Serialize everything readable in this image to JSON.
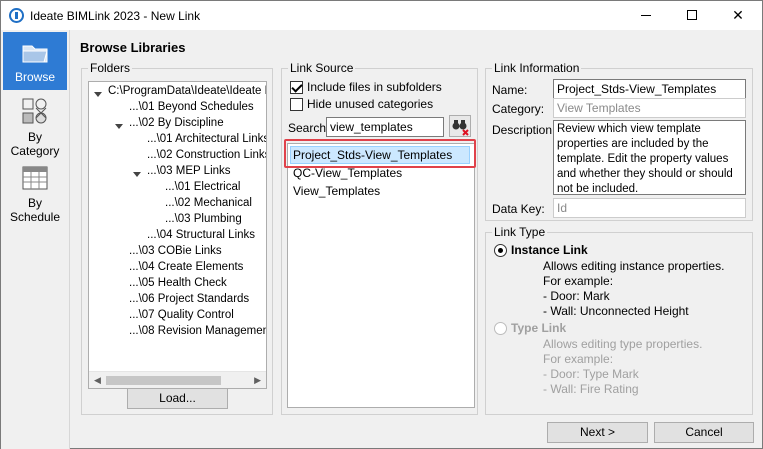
{
  "window": {
    "title": "Ideate BIMLink 2023 - New Link",
    "minimize": "—",
    "maximize": "□",
    "close": "✕"
  },
  "sidebar": {
    "items": [
      {
        "label": "Browse",
        "icon": "folder-icon"
      },
      {
        "label": "By Category",
        "icon": "category-icon"
      },
      {
        "label": "By Schedule",
        "icon": "schedule-icon"
      }
    ]
  },
  "header": "Browse Libraries",
  "folders": {
    "legend": "Folders",
    "tree": [
      "C:\\ProgramData\\Ideate\\Ideate BI",
      "...\\01 Beyond Schedules",
      "...\\02 By Discipline",
      "...\\01 Architectural Links",
      "...\\02 Construction Links",
      "...\\03 MEP Links",
      "...\\01 Electrical",
      "...\\02 Mechanical",
      "...\\03 Plumbing",
      "...\\04 Structural Links",
      "...\\03 COBie Links",
      "...\\04 Create Elements",
      "...\\05 Health Check",
      "...\\06 Project Standards",
      "...\\07 Quality Control",
      "...\\08 Revision Management"
    ],
    "load_label": "Load..."
  },
  "link_source": {
    "legend": "Link Source",
    "include_subfolders": "Include files in subfolders",
    "hide_unused": "Hide unused categories",
    "search_label": "Search:",
    "search_value": "view_templates",
    "results": [
      "Project_Stds-View_Templates",
      "QC-View_Templates",
      "View_Templates"
    ]
  },
  "link_info": {
    "legend": "Link Information",
    "name_label": "Name:",
    "name_value": "Project_Stds-View_Templates",
    "category_label": "Category:",
    "category_value": "View Templates",
    "description_label": "Description:",
    "description_value": "Review which view template properties are included by the template. Edit the property values and whether they should or should not be included.",
    "datakey_label": "Data Key:",
    "datakey_value": "Id"
  },
  "link_type": {
    "legend": "Link Type",
    "instance_label": "Instance Link",
    "instance_desc": [
      "Allows editing instance properties.",
      "For example:",
      "- Door: Mark",
      "- Wall: Unconnected Height"
    ],
    "type_label": "Type Link",
    "type_desc": [
      "Allows editing type properties.",
      "For example:",
      "- Door: Type Mark",
      "- Wall: Fire Rating"
    ]
  },
  "footer": {
    "next_label": "Next >",
    "cancel_label": "Cancel"
  }
}
